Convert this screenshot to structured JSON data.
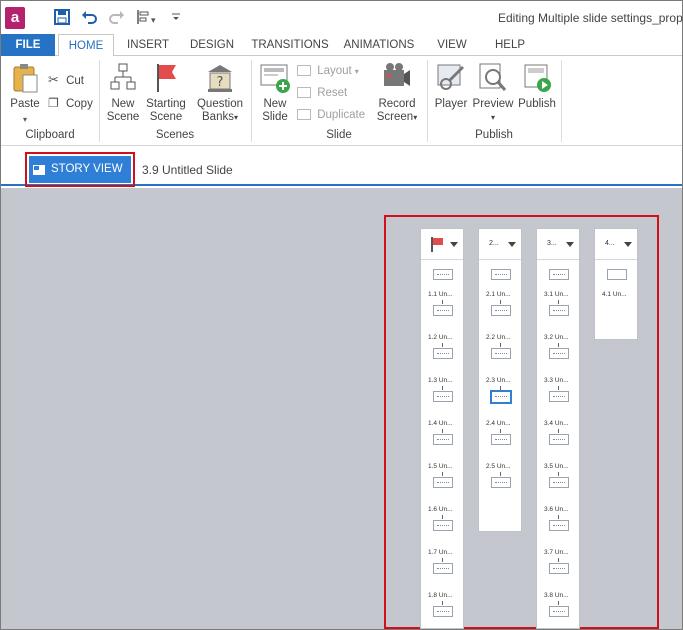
{
  "app": {
    "logo_letter": "a",
    "title": "Editing Multiple slide settings_prop",
    "qat_icons": [
      "save-icon",
      "undo-icon",
      "redo-icon",
      "slide-layout-icon",
      "customize-qat-icon"
    ]
  },
  "tabs": [
    {
      "label": "FILE",
      "name": "tab-file"
    },
    {
      "label": "HOME",
      "name": "tab-home",
      "active": true
    },
    {
      "label": "INSERT",
      "name": "tab-insert"
    },
    {
      "label": "DESIGN",
      "name": "tab-design"
    },
    {
      "label": "TRANSITIONS",
      "name": "tab-transitions"
    },
    {
      "label": "ANIMATIONS",
      "name": "tab-animations"
    },
    {
      "label": "VIEW",
      "name": "tab-view"
    },
    {
      "label": "HELP",
      "name": "tab-help"
    }
  ],
  "ribbon": {
    "clipboard": {
      "label": "Clipboard",
      "paste": "Paste",
      "cut": "Cut",
      "copy": "Copy"
    },
    "scenes": {
      "label": "Scenes",
      "new_scene_1": "New",
      "new_scene_2": "Scene",
      "starting_scene_1": "Starting",
      "starting_scene_2": "Scene",
      "question_banks_1": "Question",
      "question_banks_2": "Banks"
    },
    "slide": {
      "label": "Slide",
      "new_slide_1": "New",
      "new_slide_2": "Slide",
      "layout": "Layout",
      "reset": "Reset",
      "duplicate": "Duplicate",
      "record_screen_1": "Record",
      "record_screen_2": "Screen"
    },
    "publish": {
      "label": "Publish",
      "player": "Player",
      "preview": "Preview",
      "publish": "Publish"
    }
  },
  "storybar": {
    "story_view": "STORY VIEW",
    "breadcrumb": "3.9 Untitled Slide"
  },
  "scenes": [
    {
      "header": "",
      "start_flag": true,
      "slides": [
        "1.1 Un...",
        "1.2 Un...",
        "1.3 Un...",
        "1.4 Un...",
        "1.5 Un...",
        "1.6 Un...",
        "1.7 Un...",
        "1.8 Un..."
      ]
    },
    {
      "header": "2...",
      "start_flag": false,
      "slides": [
        "2.1 Un...",
        "2.2 Un...",
        "2.3 Un...",
        "2.4 Un...",
        "2.5 Un..."
      ],
      "selected_index": 3
    },
    {
      "header": "3...",
      "start_flag": false,
      "slides": [
        "3.1 Un...",
        "3.2 Un...",
        "3.3 Un...",
        "3.4 Un...",
        "3.5 Un...",
        "3.6 Un...",
        "3.7 Un...",
        "3.8 Un..."
      ]
    },
    {
      "header": "4...",
      "start_flag": false,
      "slides": [
        "4.1 Un..."
      ],
      "empty_first": true
    }
  ]
}
